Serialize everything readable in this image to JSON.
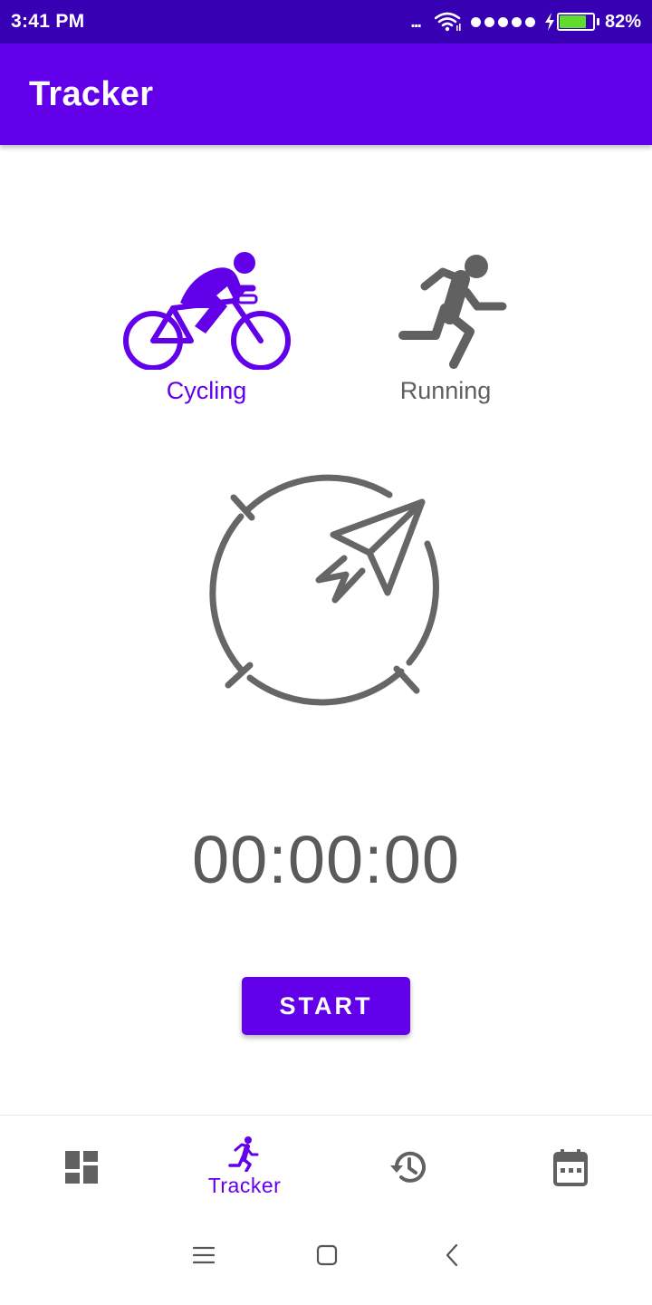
{
  "status_bar": {
    "time": "3:41 PM",
    "overflow": "...",
    "battery_percent": "82%",
    "battery_level": 0.82
  },
  "app_bar": {
    "title": "Tracker"
  },
  "activities": [
    {
      "label": "Cycling",
      "icon": "bicycle-icon",
      "selected": true
    },
    {
      "label": "Running",
      "icon": "running-icon",
      "selected": false
    }
  ],
  "compass": {
    "icon": "compass-icon"
  },
  "timer": {
    "value": "00:00:00"
  },
  "start_button": {
    "label": "START"
  },
  "bottom_nav": {
    "items": [
      {
        "icon": "dashboard-icon",
        "label": "",
        "active": false
      },
      {
        "icon": "running-icon",
        "label": "Tracker",
        "active": true
      },
      {
        "icon": "history-icon",
        "label": "",
        "active": false
      },
      {
        "icon": "calendar-icon",
        "label": "",
        "active": false
      }
    ]
  },
  "system_nav": {
    "buttons": [
      "menu-icon",
      "home-icon",
      "back-icon"
    ]
  },
  "colors": {
    "primary": "#6200ea",
    "primary_dark": "#3700b3",
    "inactive": "#5f5f5f",
    "battery": "#5fdc2c"
  }
}
